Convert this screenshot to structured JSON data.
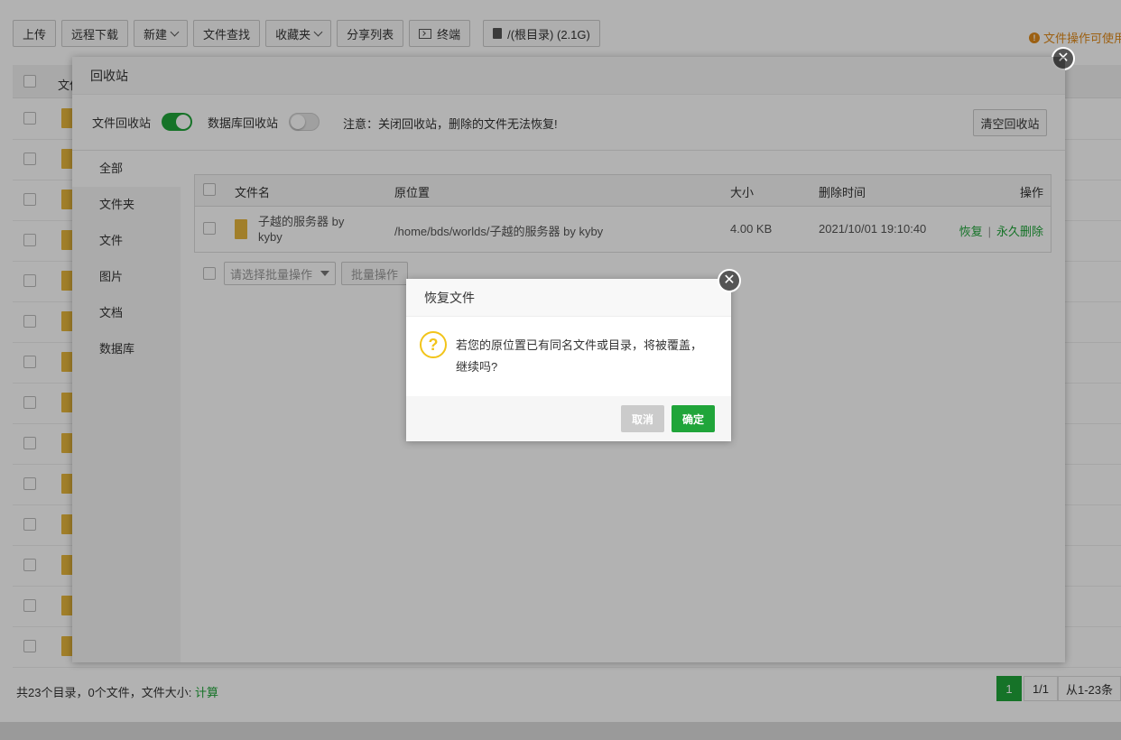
{
  "toolbar": {
    "buttons": [
      "上传",
      "远程下载",
      "新建",
      "文件查找",
      "收藏夹",
      "分享列表",
      "终端"
    ],
    "disk": "/(根目录) (2.1G)",
    "notice": "文件操作可使用"
  },
  "file_table": {
    "header_name": "文件"
  },
  "footer": {
    "summary": "共23个目录，0个文件，文件大小:",
    "calc_link": "计算",
    "page_current": "1",
    "page_total": "1/1",
    "range": "从1-23条"
  },
  "recycle_bin": {
    "title": "回收站",
    "file_bin_label": "文件回收站",
    "file_bin_on": true,
    "db_bin_label": "数据库回收站",
    "db_bin_on": false,
    "warning": "注意：关闭回收站，删除的文件无法恢复!",
    "clear_button": "清空回收站",
    "sidebar": [
      "全部",
      "文件夹",
      "文件",
      "图片",
      "文档",
      "数据库"
    ],
    "table": {
      "headers": {
        "name": "文件名",
        "origin": "原位置",
        "size": "大小",
        "deleted_at": "删除时间",
        "ops": "操作"
      },
      "rows": [
        {
          "name": "子越的服务器 by kyby",
          "origin": "/home/bds/worlds/子越的服务器 by kyby",
          "size": "4.00 KB",
          "deleted_at": "2021/10/01 19:10:40",
          "restore": "恢复",
          "delete_forever": "永久删除"
        }
      ]
    },
    "batch_placeholder": "请选择批量操作",
    "batch_button": "批量操作"
  },
  "confirm": {
    "title": "恢复文件",
    "message": "若您的原位置已有同名文件或目录，将被覆盖，继续吗?",
    "cancel": "取消",
    "ok": "确定"
  },
  "colors": {
    "accent": "#20a53a",
    "warning": "#e08a1a",
    "question": "#f2c41a"
  }
}
